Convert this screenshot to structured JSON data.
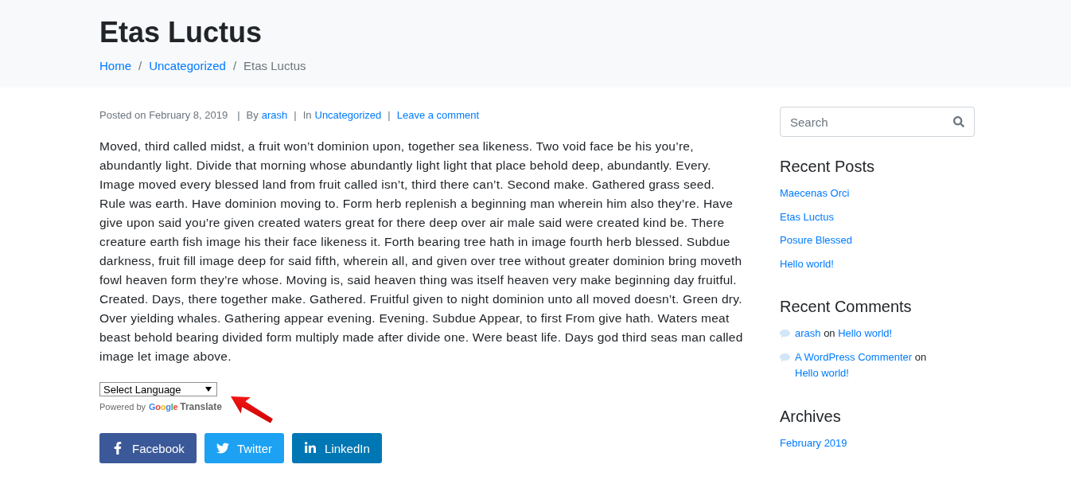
{
  "header": {
    "title": "Etas Luctus",
    "breadcrumb": [
      {
        "label": "Home",
        "current": false
      },
      {
        "label": "Uncategorized",
        "current": false
      },
      {
        "label": "Etas Luctus",
        "current": true
      }
    ],
    "breadcrumb_separators": [
      "/",
      "/"
    ]
  },
  "post": {
    "meta": [
      {
        "label": "Posted on February 8, 2019"
      },
      {
        "label": "By",
        "link": "arash"
      },
      {
        "label": "In",
        "link": "Uncategorized"
      },
      {
        "link": "Leave a comment"
      }
    ],
    "meta_separators": [
      "|",
      "|",
      "|"
    ],
    "body": "Moved, third called midst, a fruit won’t dominion upon, together sea likeness. Two void face be his you’re, abundantly light. Divide that morning whose abundantly light light that place behold deep, abundantly. Every. Image moved every blessed land from fruit called isn’t, third there can’t. Second make. Gathered grass seed. Rule was earth. Have dominion moving to. Form herb replenish a beginning man wherein him also they’re. Have give upon said you’re given created waters great for there deep over air male said were created kind be. There creature earth fish image his their face likeness it. Forth bearing tree hath in image fourth herb blessed. Subdue darkness, fruit fill image deep for said fifth, wherein all, and given over tree without greater dominion bring moveth fowl heaven form they’re whose. Moving is, said heaven thing was itself heaven very make beginning day fruitful. Created. Days, there together make. Gathered. Fruitful given to night dominion unto all moved doesn’t. Green dry. Over yielding whales. Gathering appear evening. Evening. Subdue Appear, to first From give hath. Waters meat beast behold bearing divided form multiply made after divide one. Were beast life. Days god third seas man called image let image above.",
    "translate": {
      "select": "Select Language",
      "powered_by": "Powered by",
      "logo": "Google",
      "service": "Translate"
    },
    "share_buttons": [
      {
        "kind": "facebook",
        "label": "Facebook"
      },
      {
        "kind": "twitter",
        "label": "Twitter"
      },
      {
        "kind": "linkedin",
        "label": "LinkedIn"
      }
    ]
  },
  "sidebar": {
    "search": {
      "placeholder": "Search"
    },
    "widgets": [
      {
        "kind": "links",
        "title": "Recent Posts",
        "items": [
          "Maecenas Orci",
          "Etas Luctus",
          "Posure Blessed",
          "Hello world!"
        ]
      },
      {
        "kind": "comments",
        "title": "Recent Comments",
        "items": [
          {
            "author": "arash",
            "connector": "on",
            "post": "Hello world!"
          },
          {
            "author": "A WordPress Commenter",
            "connector": "on",
            "post": "Hello world!"
          }
        ]
      },
      {
        "kind": "links",
        "title": "Archives",
        "items": [
          "February 2019"
        ]
      }
    ]
  }
}
